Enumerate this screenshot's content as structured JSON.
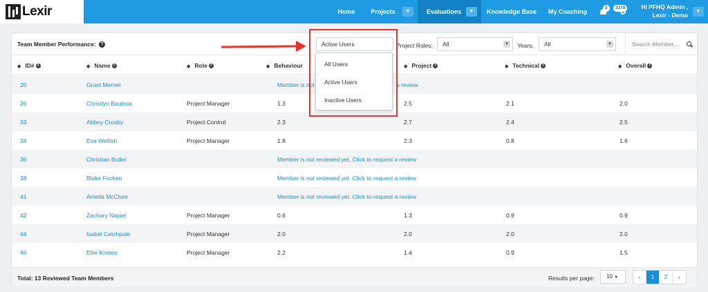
{
  "app": {
    "logo_text": "Lexir"
  },
  "nav": {
    "items": [
      {
        "label": "Home"
      },
      {
        "label": "Projects"
      },
      {
        "label": "Evaluations"
      },
      {
        "label": "Knowledge Base"
      },
      {
        "label": "My Coaching"
      }
    ],
    "notifications_count": "3",
    "points_count": "3378",
    "greeting_line1": "Hi PFHQ Admin ,",
    "greeting_line2": "Lexir - Demo"
  },
  "filters": {
    "title": "Team Member Performance:",
    "user_filter_value": "Active Users",
    "project_roles_label": "Project Roles:",
    "project_roles_value": "All",
    "years_label": "Years:",
    "years_value": "All",
    "search_placeholder": "Search Member..."
  },
  "dropdown": {
    "options": [
      "All Users",
      "Active Users",
      "Inactive Users"
    ]
  },
  "table": {
    "columns": [
      "ID#",
      "Name",
      "Role",
      "Behaviour",
      "Project",
      "Technical",
      "Overall"
    ],
    "rows": [
      {
        "id": "20",
        "name": "Grant Merriel",
        "role": "",
        "behaviour": "Member is not",
        "project": "a review",
        "technical": "",
        "overall": ""
      },
      {
        "id": "26",
        "name": "Christlyn Bautista",
        "role": "Project Manager",
        "behaviour": "1.3",
        "project": "2.5",
        "technical": "2.1",
        "overall": "2.0"
      },
      {
        "id": "33",
        "name": "Abbey Crosby",
        "role": "Project Control",
        "behaviour": "2.3",
        "project": "2.7",
        "technical": "2.4",
        "overall": "2.5"
      },
      {
        "id": "34",
        "name": "Eva Wellish",
        "role": "Project Manager",
        "behaviour": "1.8",
        "project": "2.3",
        "technical": "0.8",
        "overall": "1.6"
      },
      {
        "id": "36",
        "name": "Christian Butler",
        "role": "",
        "behaviour": "Member is not reviewed yet. Click to request a review",
        "project": "",
        "technical": "",
        "overall": ""
      },
      {
        "id": "38",
        "name": "Blake Focken",
        "role": "",
        "behaviour": "Member is not reviewed yet. Click to request a review",
        "project": "",
        "technical": "",
        "overall": ""
      },
      {
        "id": "41",
        "name": "Amelia McClure",
        "role": "",
        "behaviour": "Member is not reviewed yet. Click to request a review",
        "project": "",
        "technical": "",
        "overall": ""
      },
      {
        "id": "42",
        "name": "Zachary Napier",
        "role": "Project Manager",
        "behaviour": "0.6",
        "project": "1.3",
        "technical": "0.9",
        "overall": "0.9"
      },
      {
        "id": "44",
        "name": "Isabel Catchpole",
        "role": "Project Manager",
        "behaviour": "2.0",
        "project": "2.0",
        "technical": "2.0",
        "overall": "2.0"
      },
      {
        "id": "46",
        "name": "Ellie Knetes",
        "role": "Project Manager",
        "behaviour": "2.2",
        "project": "1.4",
        "technical": "0.9",
        "overall": "1.5"
      }
    ]
  },
  "footer": {
    "total": "Total: 13 Reviewed Team Members",
    "results_per_page_label": "Results per page:",
    "results_per_page_value": "10",
    "pages": [
      "1",
      "2"
    ]
  },
  "colors": {
    "nav": "#1e9be3",
    "link": "#1a8fd6",
    "callout": "#e8322b"
  }
}
